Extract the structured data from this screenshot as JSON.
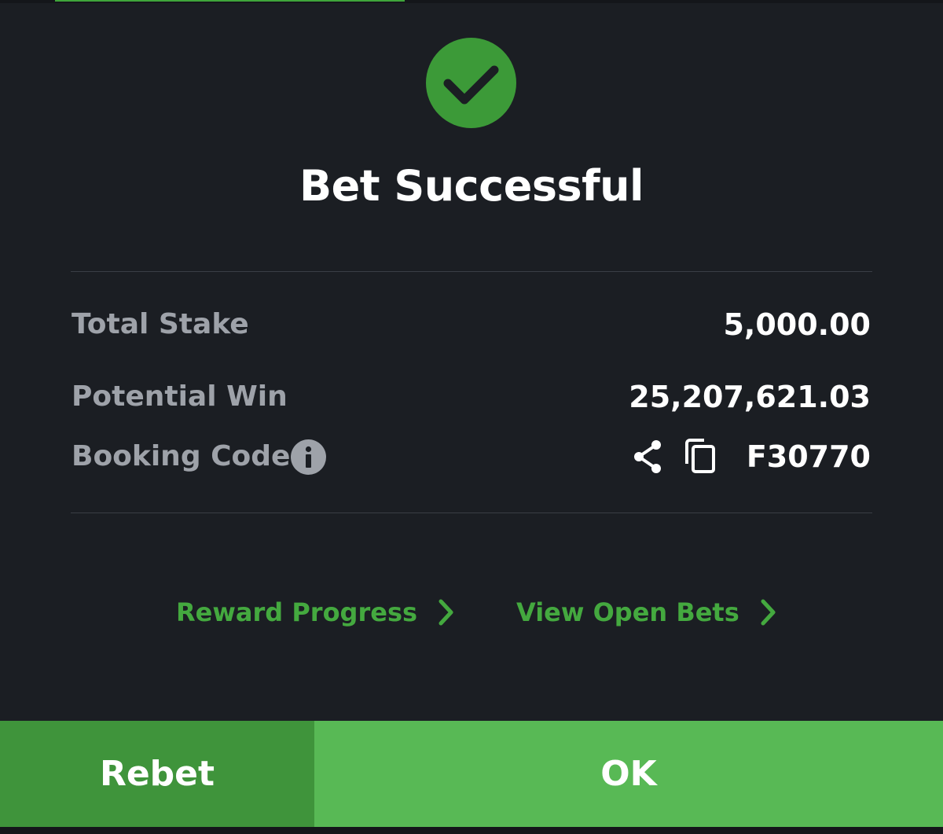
{
  "header": {
    "status_icon": "check-circle-icon",
    "title": "Bet Successful"
  },
  "summary": {
    "total_stake_label": "Total Stake",
    "total_stake_value": "5,000.00",
    "potential_win_label": "Potential Win",
    "potential_win_value": "25,207,621.03",
    "booking_code_label": "Booking Code",
    "booking_code_value": "F30770",
    "booking_code_icons": [
      "info-icon",
      "share-icon",
      "copy-icon"
    ]
  },
  "links": {
    "reward_progress": "Reward Progress",
    "view_open_bets": "View Open Bets"
  },
  "actions": {
    "rebet": "Rebet",
    "ok": "OK"
  },
  "colors": {
    "background": "#1b1e23",
    "accent_green": "#44a93f",
    "rebet_button": "#3f943b",
    "ok_button": "#58b955",
    "label_gray": "#9ea2a9"
  }
}
